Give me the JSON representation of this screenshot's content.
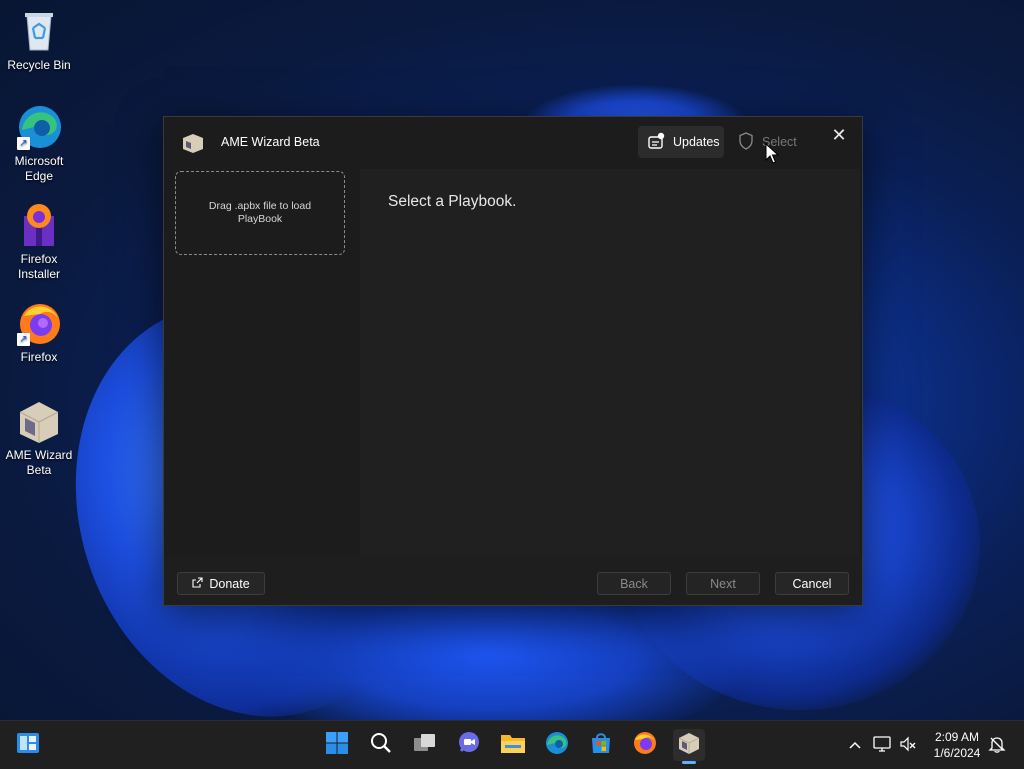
{
  "desktop": {
    "icons": [
      {
        "label": "Recycle Bin",
        "icon": "recycle-bin-icon"
      },
      {
        "label": "Microsoft Edge",
        "icon": "edge-icon"
      },
      {
        "label": "Firefox Installer",
        "icon": "firefox-installer-icon"
      },
      {
        "label": "Firefox",
        "icon": "firefox-icon"
      },
      {
        "label": "AME Wizard Beta",
        "icon": "ame-wizard-icon"
      }
    ]
  },
  "window": {
    "title": "AME Wizard Beta",
    "updates_label": "Updates",
    "select_label": "Select",
    "dropzone_text": "Drag .apbx file to load PlayBook",
    "heading": "Select a Playbook.",
    "donate_label": "Donate",
    "back_label": "Back",
    "next_label": "Next",
    "cancel_label": "Cancel"
  },
  "taskbar": {
    "time": "2:09 AM",
    "date": "1/6/2024",
    "apps": [
      "widgets-icon",
      "start-icon",
      "search-icon",
      "task-view-icon",
      "teams-chat-icon",
      "file-explorer-icon",
      "edge-icon",
      "store-icon",
      "firefox-icon",
      "ame-wizard-icon"
    ]
  },
  "colors": {
    "window_bg": "#1c1c1c",
    "content_bg": "#202020",
    "taskbar_bg": "#202020",
    "accent": "#60b0ff"
  }
}
